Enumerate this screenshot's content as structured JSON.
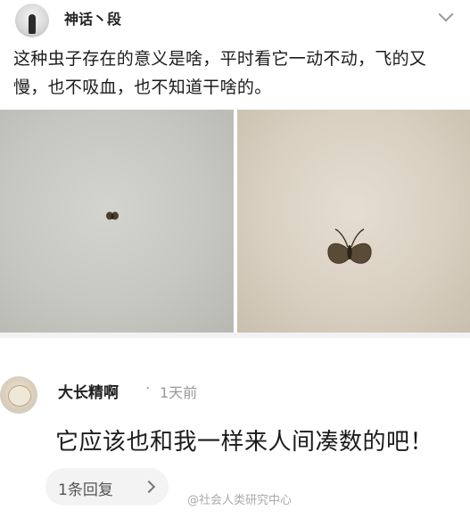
{
  "post": {
    "username": "神话丶段",
    "text": "这种虫子存在的意义是啥，平时看它一动不动，飞的又慢，也不吸血，也不知道干啥的。",
    "icons": {
      "avatar": "avatar-icon",
      "menu": "chevron-down-icon"
    }
  },
  "comment": {
    "username": "大长精啊",
    "separator": "·",
    "time": "1天前",
    "text": "它应该也和我一样来人间凑数的吧！",
    "replies_label": "1条回复",
    "icons": {
      "avatar": "avatar-icon",
      "reply_chevron": "chevron-right-icon"
    }
  },
  "watermark": "@社会人类研究中心",
  "colors": {
    "divider": "#f2f2f2",
    "muted": "#999999",
    "pill": "#f3f3f3"
  }
}
